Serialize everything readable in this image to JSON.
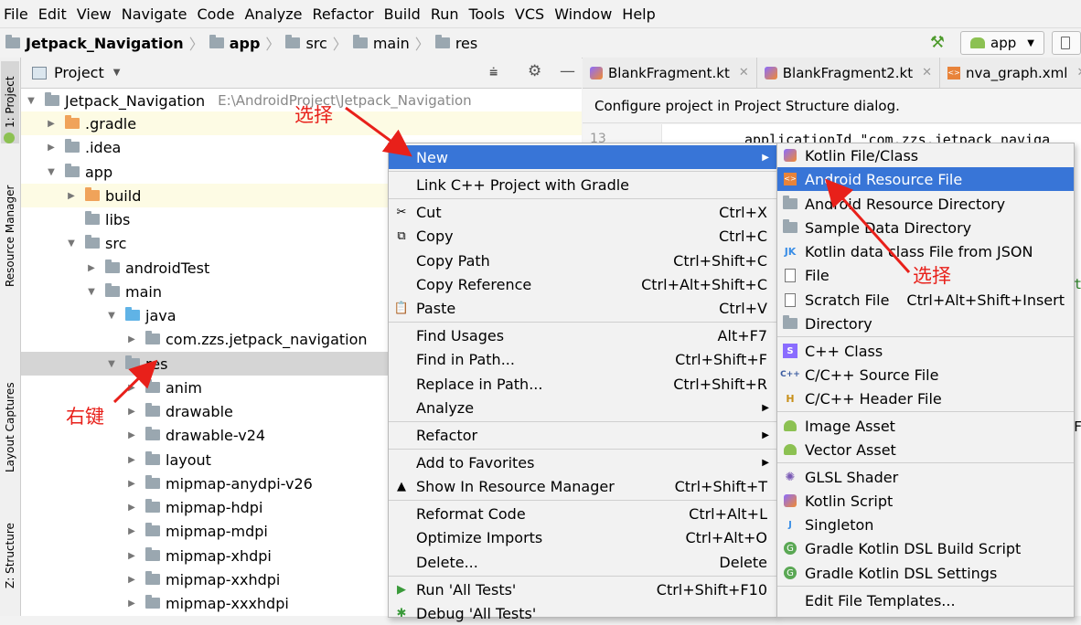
{
  "menubar": [
    "File",
    "Edit",
    "View",
    "Navigate",
    "Code",
    "Analyze",
    "Refactor",
    "Build",
    "Run",
    "Tools",
    "VCS",
    "Window",
    "Help"
  ],
  "breadcrumb": [
    "Jetpack_Navigation",
    "app",
    "src",
    "main",
    "res"
  ],
  "run_config": "app",
  "left_tabs": [
    "1: Project",
    "Resource Manager",
    "Layout Captures",
    "Z: Structure"
  ],
  "project_panel": {
    "title": "Project",
    "tree": [
      {
        "label": "Jetpack_Navigation",
        "path": "E:\\AndroidProject\\Jetpack_Navigation"
      },
      {
        "label": ".gradle"
      },
      {
        "label": ".idea"
      },
      {
        "label": "app"
      },
      {
        "label": "build"
      },
      {
        "label": "libs"
      },
      {
        "label": "src"
      },
      {
        "label": "androidTest"
      },
      {
        "label": "main"
      },
      {
        "label": "java"
      },
      {
        "label": "com.zzs.jetpack_navigation"
      },
      {
        "label": "res"
      },
      {
        "label": "anim"
      },
      {
        "label": "drawable"
      },
      {
        "label": "drawable-v24"
      },
      {
        "label": "layout"
      },
      {
        "label": "mipmap-anydpi-v26"
      },
      {
        "label": "mipmap-hdpi"
      },
      {
        "label": "mipmap-mdpi"
      },
      {
        "label": "mipmap-xhdpi"
      },
      {
        "label": "mipmap-xxhdpi"
      },
      {
        "label": "mipmap-xxxhdpi"
      }
    ]
  },
  "editor": {
    "tabs": [
      "BlankFragment.kt",
      "BlankFragment2.kt",
      "nva_graph.xml"
    ],
    "banner": "Configure project in Project Structure dialog.",
    "line_number": "13",
    "code_line": "applicationId \"com.zzs.jetpack_naviga",
    "edge_chars": [
      "t",
      "F"
    ]
  },
  "context_menu": {
    "items": [
      {
        "label": "New",
        "shortcut": ""
      },
      {
        "label": "Link C++ Project with Gradle",
        "shortcut": ""
      },
      {
        "label": "Cut",
        "shortcut": "Ctrl+X"
      },
      {
        "label": "Copy",
        "shortcut": "Ctrl+C"
      },
      {
        "label": "Copy Path",
        "shortcut": "Ctrl+Shift+C"
      },
      {
        "label": "Copy Reference",
        "shortcut": "Ctrl+Alt+Shift+C"
      },
      {
        "label": "Paste",
        "shortcut": "Ctrl+V"
      },
      {
        "label": "Find Usages",
        "shortcut": "Alt+F7"
      },
      {
        "label": "Find in Path...",
        "shortcut": "Ctrl+Shift+F"
      },
      {
        "label": "Replace in Path...",
        "shortcut": "Ctrl+Shift+R"
      },
      {
        "label": "Analyze",
        "shortcut": ""
      },
      {
        "label": "Refactor",
        "shortcut": ""
      },
      {
        "label": "Add to Favorites",
        "shortcut": ""
      },
      {
        "label": "Show In Resource Manager",
        "shortcut": "Ctrl+Shift+T"
      },
      {
        "label": "Reformat Code",
        "shortcut": "Ctrl+Alt+L"
      },
      {
        "label": "Optimize Imports",
        "shortcut": "Ctrl+Alt+O"
      },
      {
        "label": "Delete...",
        "shortcut": "Delete"
      },
      {
        "label": "Run 'All Tests'",
        "shortcut": "Ctrl+Shift+F10"
      },
      {
        "label": "Debug 'All Tests'",
        "shortcut": ""
      }
    ]
  },
  "new_submenu": {
    "items": [
      {
        "label": "Kotlin File/Class",
        "shortcut": ""
      },
      {
        "label": "Android Resource File",
        "shortcut": ""
      },
      {
        "label": "Android Resource Directory",
        "shortcut": ""
      },
      {
        "label": "Sample Data Directory",
        "shortcut": ""
      },
      {
        "label": "Kotlin data class File from JSON",
        "shortcut": ""
      },
      {
        "label": "File",
        "shortcut": ""
      },
      {
        "label": "Scratch File",
        "shortcut": "Ctrl+Alt+Shift+Insert"
      },
      {
        "label": "Directory",
        "shortcut": ""
      },
      {
        "label": "C++ Class",
        "shortcut": ""
      },
      {
        "label": "C/C++ Source File",
        "shortcut": ""
      },
      {
        "label": "C/C++ Header File",
        "shortcut": ""
      },
      {
        "label": "Image Asset",
        "shortcut": ""
      },
      {
        "label": "Vector Asset",
        "shortcut": ""
      },
      {
        "label": "GLSL Shader",
        "shortcut": ""
      },
      {
        "label": "Kotlin Script",
        "shortcut": ""
      },
      {
        "label": "Singleton",
        "shortcut": ""
      },
      {
        "label": "Gradle Kotlin DSL Build Script",
        "shortcut": ""
      },
      {
        "label": "Gradle Kotlin DSL Settings",
        "shortcut": ""
      },
      {
        "label": "Edit File Templates...",
        "shortcut": ""
      }
    ]
  },
  "annotations": {
    "select_1": "选择",
    "select_2": "选择",
    "right_click": "右键"
  },
  "colors": {
    "selection": "#3875d7",
    "annotation": "#e8201a",
    "highlight_row": "#fdfbe4",
    "selected_tree_row": "#d5d5d5"
  }
}
